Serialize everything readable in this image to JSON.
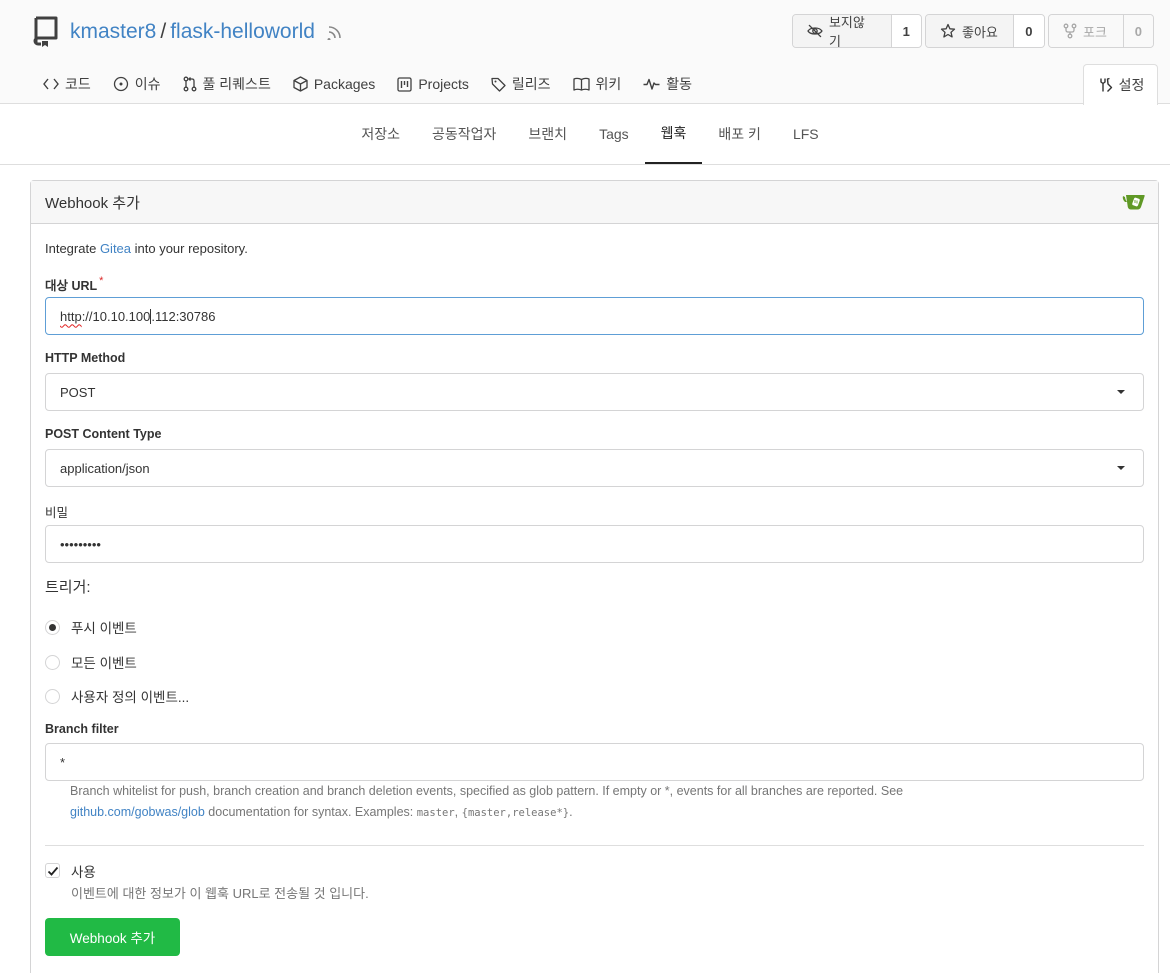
{
  "repo": {
    "owner": "kmaster8",
    "separator": "/",
    "name": "flask-helloworld"
  },
  "actions": {
    "watch": {
      "label": "보지않기",
      "count": "1"
    },
    "star": {
      "label": "좋아요",
      "count": "0"
    },
    "fork": {
      "label": "포크",
      "count": "0"
    }
  },
  "nav": {
    "code": "코드",
    "issues": "이슈",
    "pulls": "풀 리퀘스트",
    "packages": "Packages",
    "projects": "Projects",
    "releases": "릴리즈",
    "wiki": "위키",
    "activity": "활동",
    "settings": "설정"
  },
  "subnav": {
    "repository": "저장소",
    "collaborators": "공동작업자",
    "branches": "브랜치",
    "tags": "Tags",
    "webhooks": "웹훅",
    "deploy_keys": "배포 키",
    "lfs": "LFS"
  },
  "card": {
    "title": "Webhook 추가"
  },
  "form": {
    "intro_prefix": "Integrate ",
    "intro_link": "Gitea",
    "intro_suffix": " into your repository.",
    "url_label": "대상 URL",
    "url_required": "*",
    "url_value_proto": "http",
    "url_value_mid": "://10.10.100",
    "url_value_rest": ".112:30786",
    "method_label": "HTTP Method",
    "method_value": "POST",
    "content_type_label": "POST Content Type",
    "content_type_value": "application/json",
    "secret_label": "비밀",
    "secret_value": "•••••••••",
    "trigger_title": "트리거:",
    "trigger_push": "푸시 이벤트",
    "trigger_all": "모든 이벤트",
    "trigger_custom": "사용자 정의 이벤트...",
    "branch_filter_label": "Branch filter",
    "branch_filter_value": "*",
    "help_text_1": "Branch whitelist for push, branch creation and branch deletion events, specified as glob pattern. If empty or *, events for all branches are reported. See",
    "help_link": "github.com/gobwas/glob",
    "help_text_2": " documentation for syntax. Examples: ",
    "help_code_1": "master",
    "help_comma": ", ",
    "help_code_2": "{master,release*}",
    "help_end": ".",
    "active_label": "사용",
    "active_desc": "이벤트에 대한 정보가 이 웹훅 URL로 전송될 것 입니다.",
    "submit_label": "Webhook 추가"
  },
  "colors": {
    "link": "#4183c4",
    "primary_green": "#21ba45",
    "required": "#db2828"
  }
}
